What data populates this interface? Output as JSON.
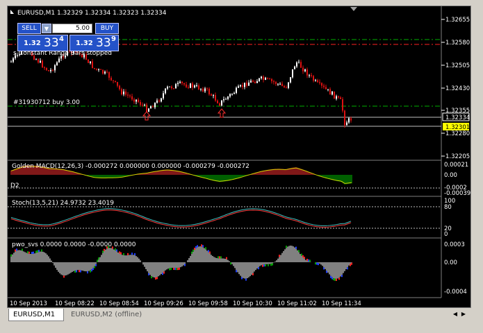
{
  "symbol_header": "EURUSD,M1  1.32329 1.32334 1.32323 1.32334",
  "trade_panel": {
    "sell_label": "SELL",
    "buy_label": "BUY",
    "lot_value": "5.00",
    "bid_prefix": "1.32",
    "bid_big": "33",
    "bid_sup": "4",
    "ask_prefix": "1.32",
    "ask_big": "33",
    "ask_sup": "9"
  },
  "main_pane": {
    "indicator_label": "s-Constant Range Bars stopped",
    "order_label": "#31930712 buy 3.00",
    "price_ticks": [
      "1.32655",
      "1.32580",
      "1.32505",
      "1.32430",
      "1.32355",
      "1.32280",
      "1.32205"
    ],
    "ask_marker": "1.32334",
    "bid_marker": "1.32301"
  },
  "macd_pane": {
    "label": "Golden MACD(12,26,3) -0.000272 0.000000 0.000000 -0.000279 -0.000272",
    "sub_label": "D2",
    "ticks": [
      "0.00021",
      "0.00",
      "-0.0002",
      "-0.00039"
    ]
  },
  "stoch_pane": {
    "label": "Stoch(13,5,21) 24.9732 23.4019",
    "ticks": [
      "100",
      "80",
      "20",
      "0"
    ]
  },
  "pwo_pane": {
    "label": "pwo_svs 0.0000 0.0000 -0.0000 0.0000",
    "ticks": [
      "0.0003",
      "0.00",
      "-0.0004"
    ]
  },
  "time_axis": [
    "10 Sep 2013",
    "10 Sep 08:22",
    "10 Sep 08:54",
    "10 Sep 09:26",
    "10 Sep 09:58",
    "10 Sep 10:30",
    "10 Sep 11:02",
    "10 Sep 11:34"
  ],
  "tabs": [
    {
      "label": "EURUSD,M1",
      "active": true
    },
    {
      "label": "EURUSD,M2 (offline)",
      "active": false
    }
  ],
  "colors": {
    "bull": "#ffffff",
    "bear": "#dd1111",
    "grid_green": "#00b000",
    "grid_red": "#ff2020",
    "macd_green": "#00c000",
    "macd_red": "#ff3030",
    "stoch_main": "#40c0c0",
    "stoch_signal": "#ff4040",
    "panel_blue": "#2452c8",
    "bid_marker_bg": "#ffff00"
  },
  "icons": {
    "scroll_left": "triangle-left-icon",
    "scroll_right": "triangle-right-icon",
    "shift_marker": "triangle-down-icon"
  }
}
